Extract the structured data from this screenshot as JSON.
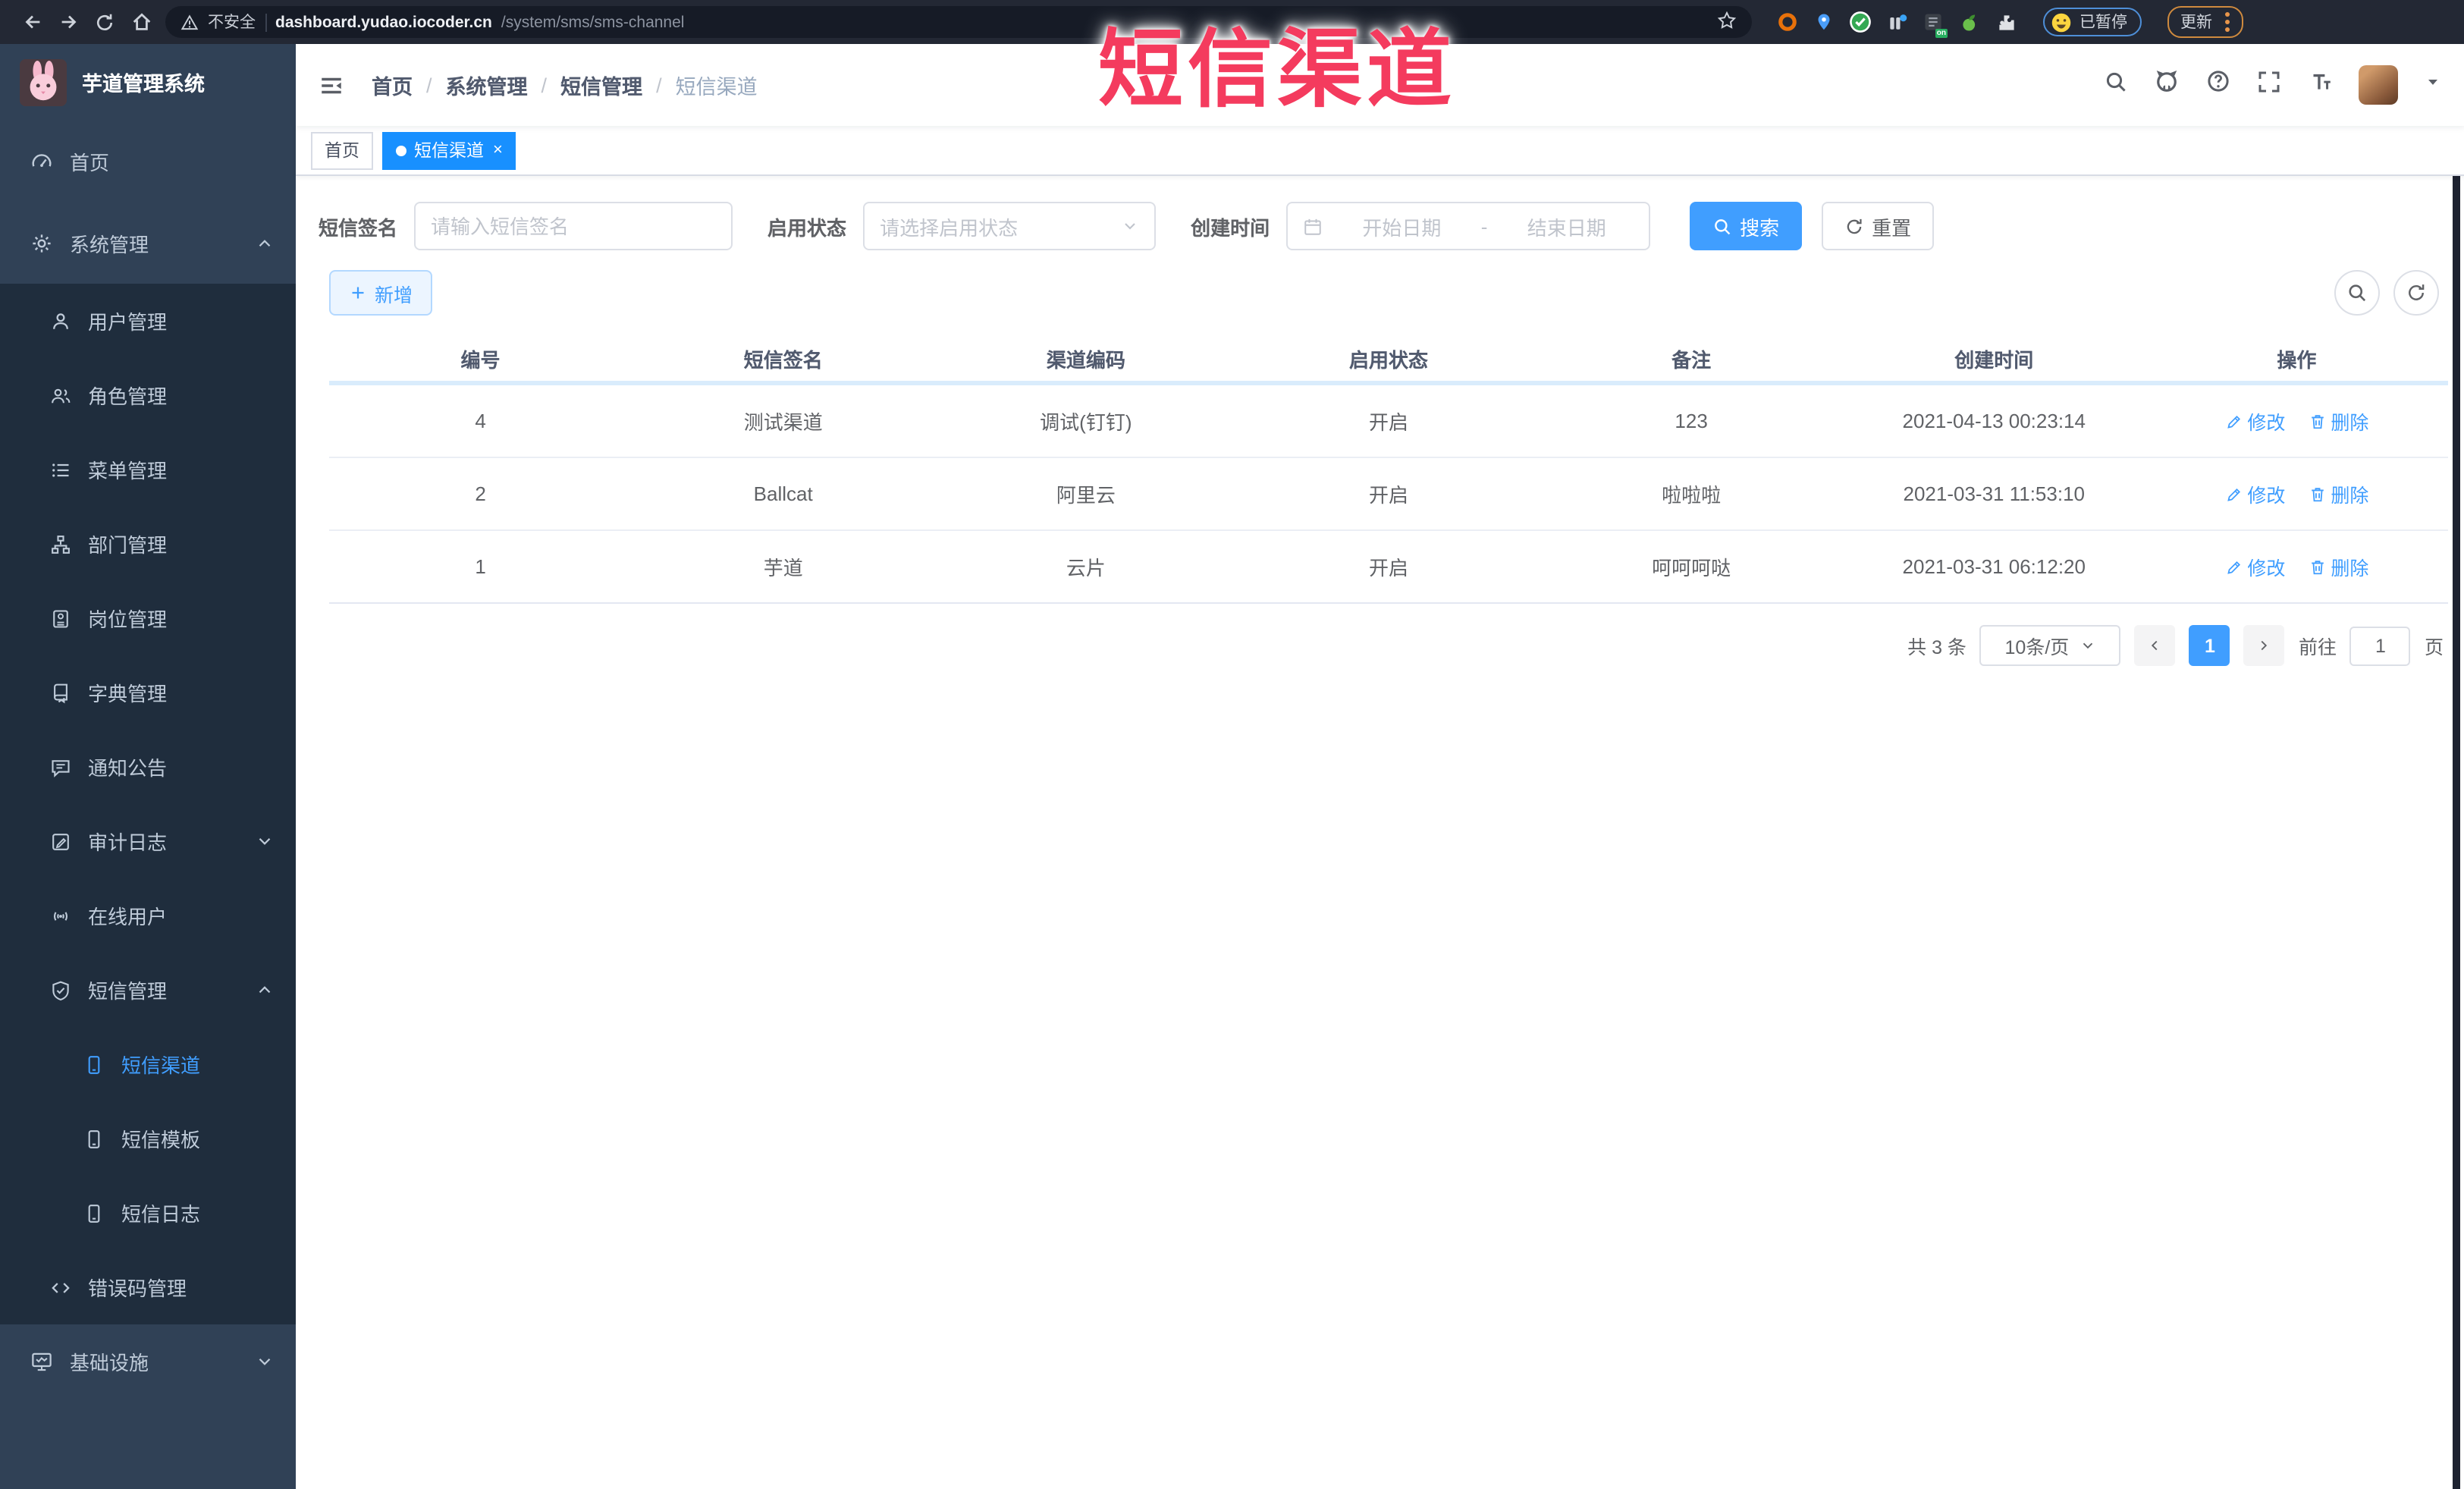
{
  "annotation": {
    "text": "短信渠道"
  },
  "browser": {
    "security": "不安全",
    "domain": "dashboard.yudao.iocoder.cn",
    "path": "/system/sms/sms-channel",
    "paused": "已暂停",
    "update": "更新",
    "ext_badge": "on"
  },
  "sidebar": {
    "title": "芋道管理系统",
    "items": [
      {
        "label": "首页"
      },
      {
        "label": "系统管理"
      },
      {
        "label": "用户管理"
      },
      {
        "label": "角色管理"
      },
      {
        "label": "菜单管理"
      },
      {
        "label": "部门管理"
      },
      {
        "label": "岗位管理"
      },
      {
        "label": "字典管理"
      },
      {
        "label": "通知公告"
      },
      {
        "label": "审计日志"
      },
      {
        "label": "在线用户"
      },
      {
        "label": "短信管理"
      },
      {
        "label": "短信渠道"
      },
      {
        "label": "短信模板"
      },
      {
        "label": "短信日志"
      },
      {
        "label": "错误码管理"
      },
      {
        "label": "基础设施"
      }
    ]
  },
  "header": {
    "breadcrumb": [
      "首页",
      "系统管理",
      "短信管理",
      "短信渠道"
    ],
    "separator": "/"
  },
  "tags": {
    "home": "首页",
    "active": "短信渠道",
    "close": "×"
  },
  "filters": {
    "sig_label": "短信签名",
    "sig_placeholder": "请输入短信签名",
    "status_label": "启用状态",
    "status_placeholder": "请选择启用状态",
    "time_label": "创建时间",
    "date_start": "开始日期",
    "date_sep": "-",
    "date_end": "结束日期",
    "search": "搜索",
    "reset": "重置"
  },
  "toolbar": {
    "add": "新增"
  },
  "table": {
    "columns": [
      "编号",
      "短信签名",
      "渠道编码",
      "启用状态",
      "备注",
      "创建时间",
      "操作"
    ],
    "rows": [
      {
        "id": "4",
        "signature": "测试渠道",
        "code": "调试(钉钉)",
        "status": "开启",
        "remark": "123",
        "created": "2021-04-13 00:23:14"
      },
      {
        "id": "2",
        "signature": "Ballcat",
        "code": "阿里云",
        "status": "开启",
        "remark": "啦啦啦",
        "created": "2021-03-31 11:53:10"
      },
      {
        "id": "1",
        "signature": "芋道",
        "code": "云片",
        "status": "开启",
        "remark": "呵呵呵哒",
        "created": "2021-03-31 06:12:20"
      }
    ],
    "edit": "修改",
    "delete": "删除"
  },
  "pagination": {
    "total": "共 3 条",
    "size": "10条/页",
    "page": "1",
    "goto": "前往",
    "goto_value": "1",
    "unit": "页"
  },
  "colors": {
    "accent": "#409eff",
    "tag_active": "#1890ff",
    "annotation": "#f43b5e",
    "sidebar_bg": "#304156",
    "submenu_bg": "#1f2d3d"
  }
}
